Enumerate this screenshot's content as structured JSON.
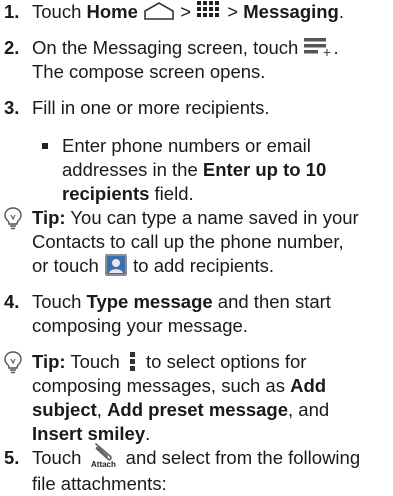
{
  "step1": {
    "num": "1.",
    "a": "Touch ",
    "home": "Home",
    "gt1": " > ",
    "gt2": " > ",
    "messaging": "Messaging",
    "end": "."
  },
  "step2": {
    "num": "2.",
    "a": "On the Messaging screen, touch ",
    "end": ".",
    "line2": "The compose screen opens."
  },
  "step3": {
    "num": "3.",
    "text": "Fill in one or more recipients."
  },
  "bullet1": {
    "l1": "Enter phone numbers or email",
    "l2a": "addresses in the ",
    "l2b": "Enter up to 10",
    "l3": "recipients",
    "l3c": " field."
  },
  "tip1": {
    "label": "Tip:",
    "l1": " You can type a name saved in your",
    "l2": "Contacts to call up the phone number,",
    "l3a": "or touch ",
    "l3b": " to add recipients."
  },
  "step4": {
    "num": "4.",
    "a": "Touch ",
    "b": "Type message",
    "c": " and then start",
    "line2": "composing your message."
  },
  "tip2": {
    "label": "Tip:",
    "l1a": " Touch ",
    "l1b": " to select options for",
    "l2": "composing messages, such as ",
    "l2b": "Add",
    "l3a": "subject",
    "l3b": ", ",
    "l3c": "Add preset message",
    "l3d": ", and",
    "l4a": "Insert smiley",
    "l4b": "."
  },
  "step5": {
    "num": "5.",
    "a": "Touch ",
    "attach": "Attach",
    "b": " and select from the following",
    "line2": "file attachments:"
  },
  "icons": {
    "home": "home-icon",
    "apps": "apps-grid-icon",
    "compose": "new-message-icon",
    "contact": "contact-icon",
    "menu": "menu-icon",
    "attach": "paperclip-icon",
    "tip": "lightbulb-icon"
  }
}
